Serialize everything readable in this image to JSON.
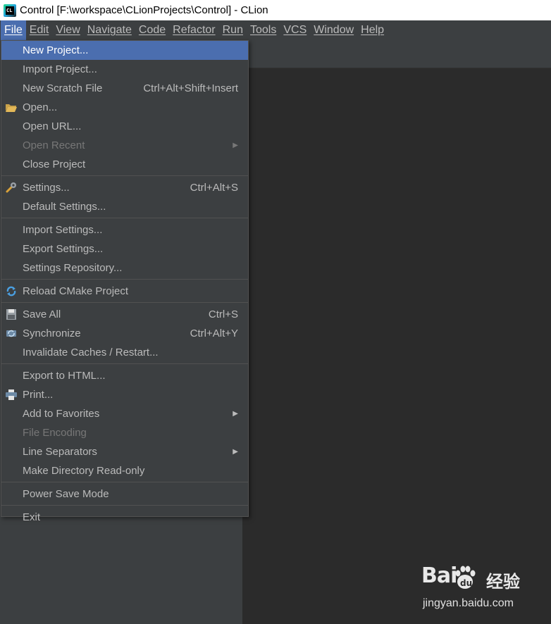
{
  "window": {
    "title": "Control [F:\\workspace\\CLionProjects\\Control] - CLion"
  },
  "menubar": {
    "items": [
      "File",
      "Edit",
      "View",
      "Navigate",
      "Code",
      "Refactor",
      "Run",
      "Tools",
      "VCS",
      "Window",
      "Help"
    ],
    "active": "File"
  },
  "file_menu": {
    "new_project": "New Project...",
    "import_project": "Import Project...",
    "new_scratch_file": "New Scratch File",
    "new_scratch_file_shortcut": "Ctrl+Alt+Shift+Insert",
    "open": "Open...",
    "open_url": "Open URL...",
    "open_recent": "Open Recent",
    "close_project": "Close Project",
    "settings": "Settings...",
    "settings_shortcut": "Ctrl+Alt+S",
    "default_settings": "Default Settings...",
    "import_settings": "Import Settings...",
    "export_settings": "Export Settings...",
    "settings_repository": "Settings Repository...",
    "reload_cmake": "Reload CMake Project",
    "save_all": "Save All",
    "save_all_shortcut": "Ctrl+S",
    "synchronize": "Synchronize",
    "synchronize_shortcut": "Ctrl+Alt+Y",
    "invalidate_caches": "Invalidate Caches / Restart...",
    "export_html": "Export to HTML...",
    "print": "Print...",
    "add_to_favorites": "Add to Favorites",
    "file_encoding": "File Encoding",
    "line_separators": "Line Separators",
    "make_readonly": "Make Directory Read-only",
    "power_save": "Power Save Mode",
    "exit": "Exit"
  },
  "watermark": {
    "brand": "Bai",
    "brand_suffix": "du",
    "cn": "经验",
    "url": "jingyan.baidu.com"
  },
  "colors": {
    "menu_bg": "#3c3f41",
    "selection": "#4b6eaf",
    "editor_bg": "#2b2b2b"
  }
}
